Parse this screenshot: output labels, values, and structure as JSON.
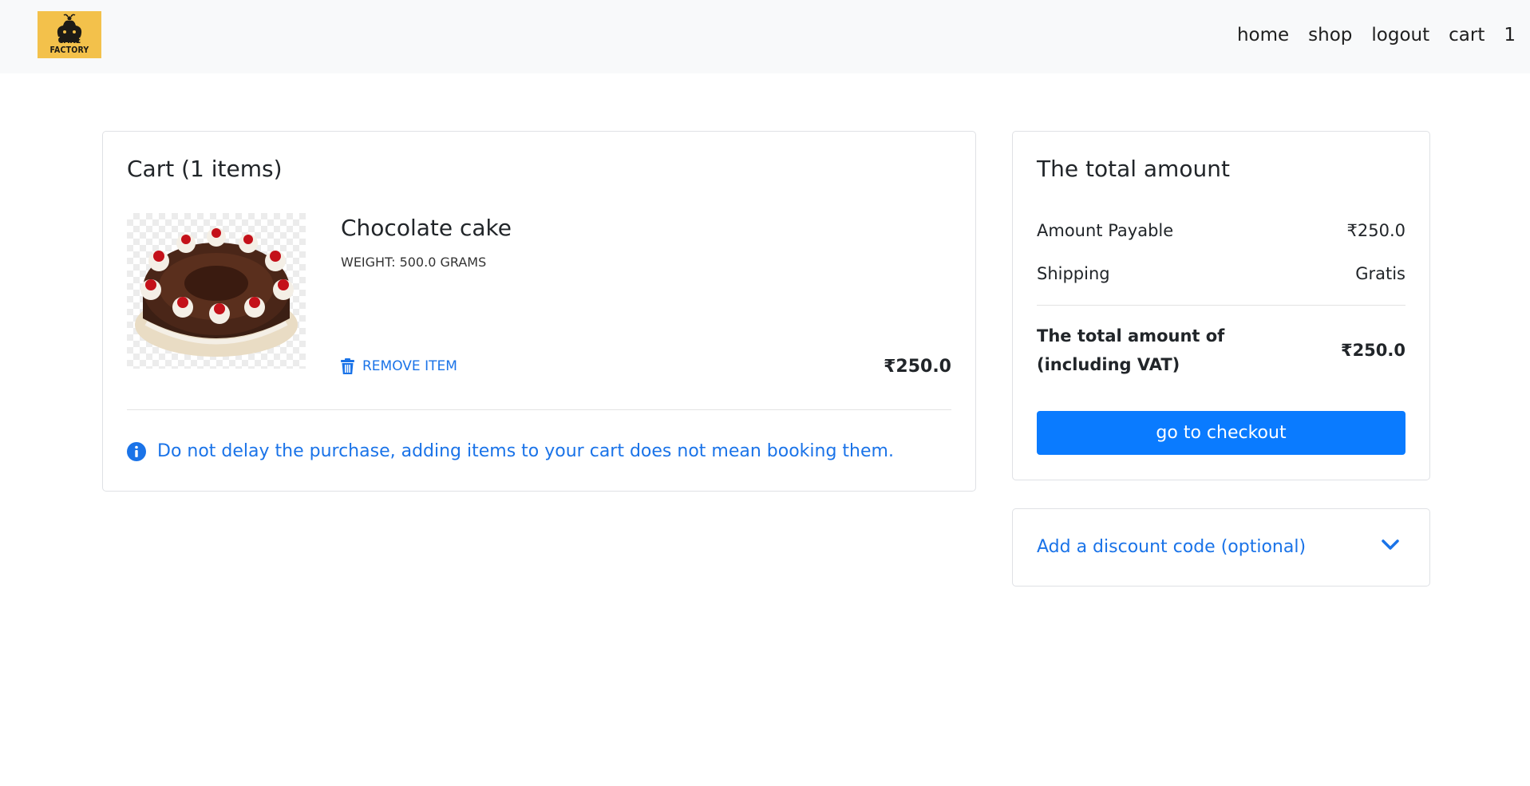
{
  "navbar": {
    "logo_text": "CAKE FACTORY",
    "links": {
      "home": "home",
      "shop": "shop",
      "logout": "logout",
      "cart": "cart"
    },
    "cart_count": "1"
  },
  "cart": {
    "title": "Cart (1 items)",
    "items": [
      {
        "name": "Chocolate cake",
        "weight": "WEIGHT: 500.0 GRAMS",
        "remove_label": "REMOVE ITEM",
        "price": "₹250.0"
      }
    ],
    "notice": "Do not delay the purchase, adding items to your cart does not mean booking them."
  },
  "summary": {
    "title": "The total amount",
    "amount_payable_label": "Amount Payable",
    "amount_payable_value": "₹250.0",
    "shipping_label": "Shipping",
    "shipping_value": "Gratis",
    "total_label": "The total amount of (including VAT)",
    "total_value": "₹250.0",
    "checkout_label": "go to checkout"
  },
  "discount": {
    "label": "Add a discount code (optional)"
  },
  "colors": {
    "accent": "#0a7bff",
    "link": "#1a73e8",
    "navbar_bg": "#f8f9fa",
    "logo_bg": "#f3c14b"
  }
}
